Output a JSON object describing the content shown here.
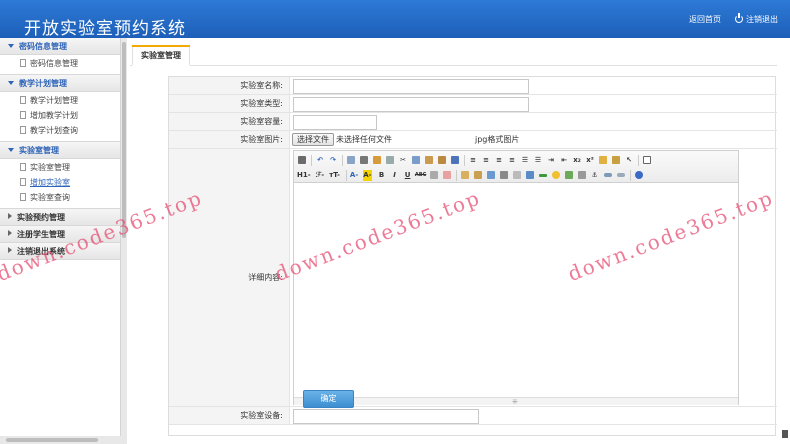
{
  "header": {
    "title": "开放实验室预约系统",
    "home_link": "返回首页",
    "logout_link": "注销退出"
  },
  "sidebar": {
    "groups": [
      {
        "title": "密码信息管理",
        "open": true,
        "items": [
          {
            "label": "密码信息管理",
            "active": false
          }
        ]
      },
      {
        "title": "教学计划管理",
        "open": true,
        "items": [
          {
            "label": "教学计划管理",
            "active": false
          },
          {
            "label": "增加教学计划",
            "active": false
          },
          {
            "label": "教学计划查询",
            "active": false
          }
        ]
      },
      {
        "title": "实验室管理",
        "open": true,
        "items": [
          {
            "label": "实验室管理",
            "active": false
          },
          {
            "label": "增加实验室",
            "active": true
          },
          {
            "label": "实验室查询",
            "active": false
          }
        ]
      },
      {
        "title": "实验预约管理",
        "open": false,
        "items": []
      },
      {
        "title": "注册学生管理",
        "open": false,
        "items": []
      },
      {
        "title": "注销退出系统",
        "open": false,
        "items": []
      }
    ]
  },
  "tab": {
    "label": "实验室管理"
  },
  "form": {
    "name_label": "实验室名称:",
    "name_value": "",
    "type_label": "实验室类型:",
    "type_value": "",
    "capacity_label": "实验室容量:",
    "capacity_value": "",
    "image_label": "实验室图片:",
    "file_button": "选择文件",
    "file_status": "未选择任何文件",
    "file_hint": "jpg格式图片",
    "detail_label": "详细内容:",
    "equipment_label": "实验室设备:",
    "equipment_value": "",
    "submit_label": "确定"
  },
  "editor": {
    "heading_menu": "H1-",
    "font_menu": "ℱ-",
    "size_menu": "тT-",
    "color_menu": "A-",
    "highlight_menu": "A-",
    "bold": "B",
    "italic": "I",
    "underline": "U",
    "strike": "ABC"
  },
  "watermark": "down.code365.top",
  "colors": {
    "header_bg": "#1d5fb8",
    "accent": "#2d63b8",
    "tab_top": "#f2a900",
    "button": "#3d8fd0",
    "watermark": "#e6466e"
  }
}
